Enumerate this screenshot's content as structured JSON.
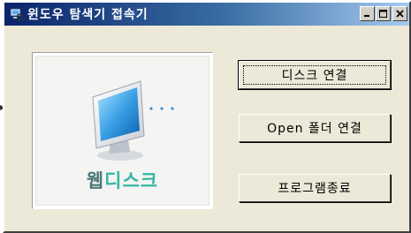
{
  "window": {
    "title": "윈도우 탐색기 접속기",
    "controls": [
      "minimize-icon",
      "maximize-icon",
      "close-icon"
    ]
  },
  "logo": {
    "icon": "monitor-icon",
    "prefix": "웹",
    "suffix": "디스크",
    "colors": {
      "prefix": "#4a7a78",
      "suffix": "#36b7a6"
    }
  },
  "buttons": {
    "disk_connect": "디스크 연결",
    "open_folder": "Open 폴더 연결",
    "exit": "프로그램종료"
  },
  "colors": {
    "titlebar_start": "#0a246a",
    "titlebar_end": "#a6caf0",
    "window_bg": "#ece9d8"
  }
}
